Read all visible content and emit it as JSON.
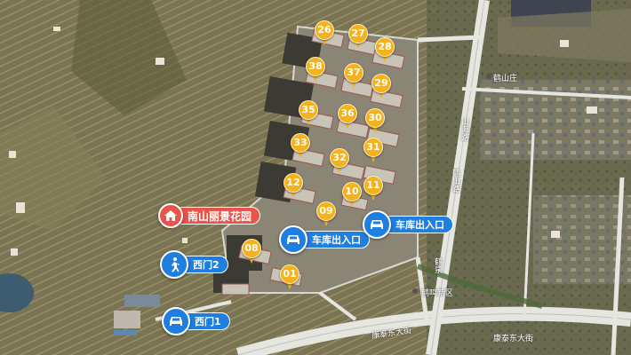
{
  "map": {
    "title_label": "南山丽景花园",
    "gates": [
      {
        "id": "west-gate-2",
        "label": "西门2",
        "icon": "pedestrian-icon"
      },
      {
        "id": "west-gate-1",
        "label": "西门1",
        "icon": "car-icon"
      }
    ],
    "garage_entrances": [
      {
        "label": "车库出入口",
        "icon": "car-icon"
      },
      {
        "label": "车库出入口",
        "icon": "car-icon"
      }
    ],
    "buildings": [
      "26",
      "27",
      "28",
      "38",
      "37",
      "29",
      "35",
      "36",
      "30",
      "33",
      "31",
      "32",
      "12",
      "10",
      "11",
      "09",
      "08",
      "01"
    ],
    "road_labels": {
      "vertical_1": "鹤山路",
      "vertical_2": "山海路",
      "horizontal_1": "康泰东大街",
      "horizontal_2": "康泰东大街",
      "village": "鹤山庄",
      "community": "鹤鸣新区",
      "small_1": "鹤泉"
    },
    "colors": {
      "pin": "#f6b21b",
      "blue_badge": "#1f7fe0",
      "red_badge": "#e8534a"
    }
  }
}
